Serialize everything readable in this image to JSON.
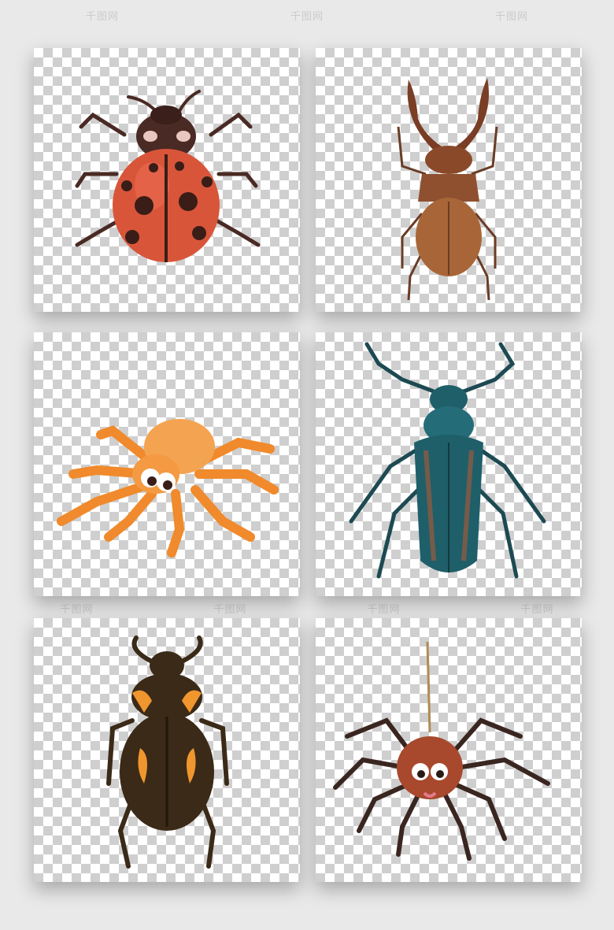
{
  "watermark": {
    "text": "千图网",
    "rows": [
      [
        "千图网",
        "千图网",
        "千图网"
      ],
      [
        "千图网",
        "千图网",
        "千图网",
        "千图网"
      ]
    ]
  },
  "tiles": [
    {
      "id": "ladybug",
      "subject": "ladybug-illustration",
      "colors": {
        "shell": "#d9553a",
        "spots": "#3a1d17",
        "head": "#4a2a24"
      }
    },
    {
      "id": "stag-beetle",
      "subject": "stag-beetle-illustration",
      "colors": {
        "body": "#9a5a35",
        "mandibles": "#7a3d25"
      }
    },
    {
      "id": "orange-spider",
      "subject": "orange-cartoon-spider-illustration",
      "colors": {
        "body": "#f4a351",
        "legs": "#f08a2c"
      }
    },
    {
      "id": "teal-beetle",
      "subject": "teal-longhorn-beetle-illustration",
      "colors": {
        "body": "#1f5f6a",
        "stripe": "#b05a35"
      }
    },
    {
      "id": "spotted-beetle",
      "subject": "black-orange-beetle-illustration",
      "colors": {
        "body": "#3a2a17",
        "spots": "#f0962e"
      }
    },
    {
      "id": "brown-spider",
      "subject": "brown-cartoon-spider-illustration",
      "colors": {
        "body": "#a8482c",
        "legs": "#3a2620"
      }
    }
  ]
}
